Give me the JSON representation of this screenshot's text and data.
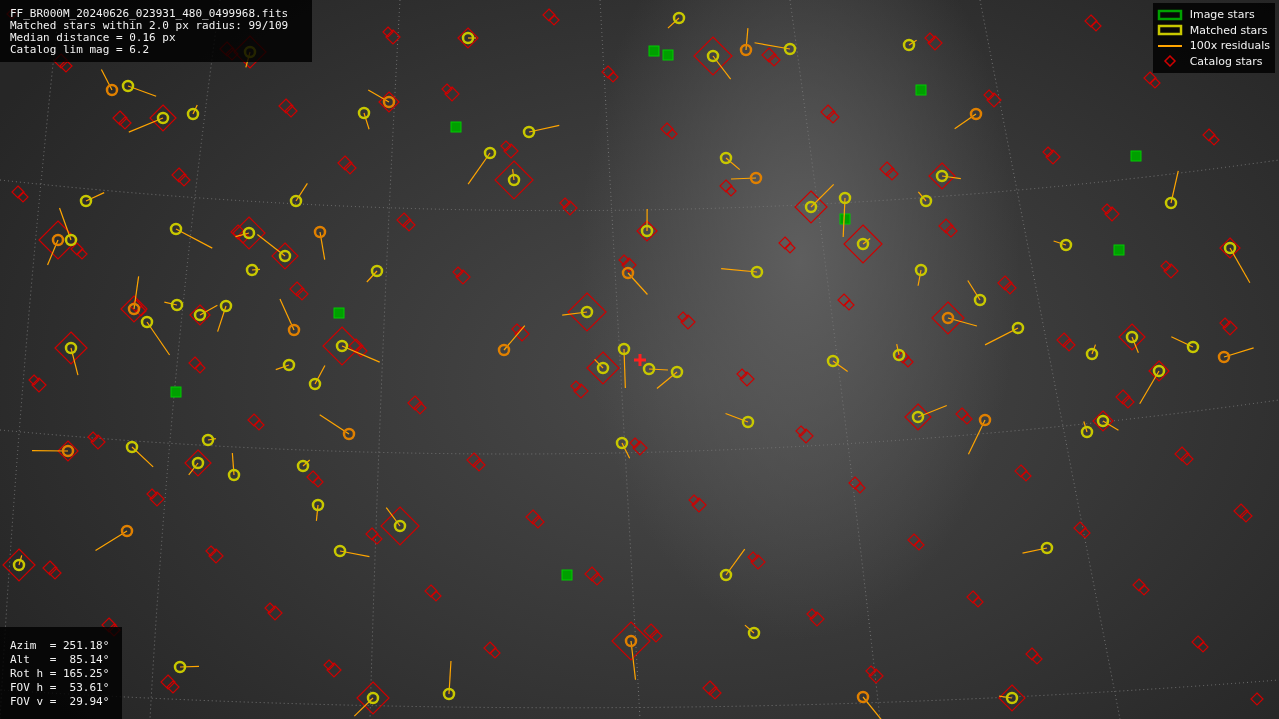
{
  "info_lines": [
    "FF_BR000M_20240626_023931_480_0499968.fits",
    "Matched stars within 2.0 px radius: 99/109",
    "Median distance = 0.16 px",
    "Catalog lim mag = 6.2"
  ],
  "legend": [
    {
      "label": "Image stars",
      "kind": "box",
      "color": "#00a000"
    },
    {
      "label": "Matched stars",
      "kind": "box",
      "color": "#c8c800"
    },
    {
      "label": "100x residuals",
      "kind": "line",
      "color": "#ffa500"
    },
    {
      "label": "Catalog stars",
      "kind": "diamond",
      "color": "#d00000"
    }
  ],
  "pointing_lines": [
    "Azim  = 251.18°",
    "Alt   =  85.14°",
    "Rot h = 165.25°",
    "FOV h =  53.61°",
    "FOV v =  29.94°"
  ]
}
